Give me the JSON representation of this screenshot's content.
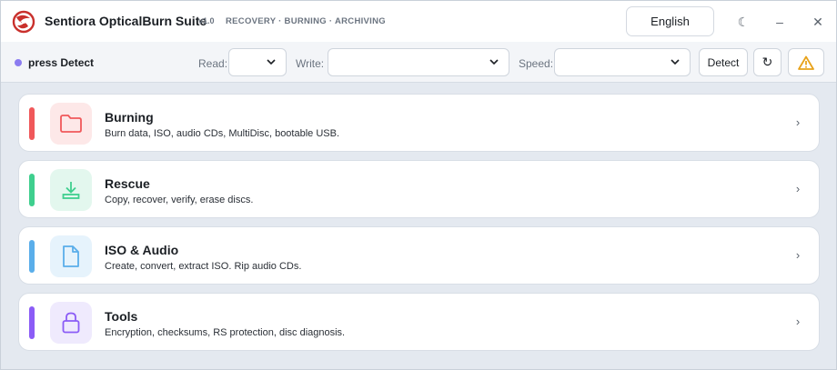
{
  "app": {
    "title": "Sentiora OpticalBurn Suite",
    "version": "v1.0",
    "tagline": "RECOVERY · BURNING · ARCHIVING",
    "language": "English",
    "theme_icon": "☾",
    "minimize_icon": "–",
    "close_icon": "✕"
  },
  "toolbar": {
    "status": "press Detect",
    "read_label": "Read:",
    "write_label": "Write:",
    "speed_label": "Speed:",
    "read_value": "",
    "write_value": "",
    "speed_value": "",
    "detect_label": "Detect",
    "refresh_icon": "↻"
  },
  "colors": {
    "burning": "#f0585a",
    "rescue": "#3fcf8e",
    "iso": "#5aaeea",
    "tools": "#8b5cf6"
  },
  "cards": [
    {
      "title": "Burning",
      "desc": "Burn data, ISO, audio CDs, MultiDisc, bootable USB.",
      "icon": "folder-icon",
      "arrow": "›"
    },
    {
      "title": "Rescue",
      "desc": "Copy, recover, verify, erase discs.",
      "icon": "download-icon",
      "arrow": "›"
    },
    {
      "title": "ISO & Audio",
      "desc": "Create, convert, extract ISO. Rip audio CDs.",
      "icon": "file-icon",
      "arrow": "›"
    },
    {
      "title": "Tools",
      "desc": "Encryption, checksums, RS protection, disc diagnosis.",
      "icon": "lock-icon",
      "arrow": "›"
    }
  ]
}
